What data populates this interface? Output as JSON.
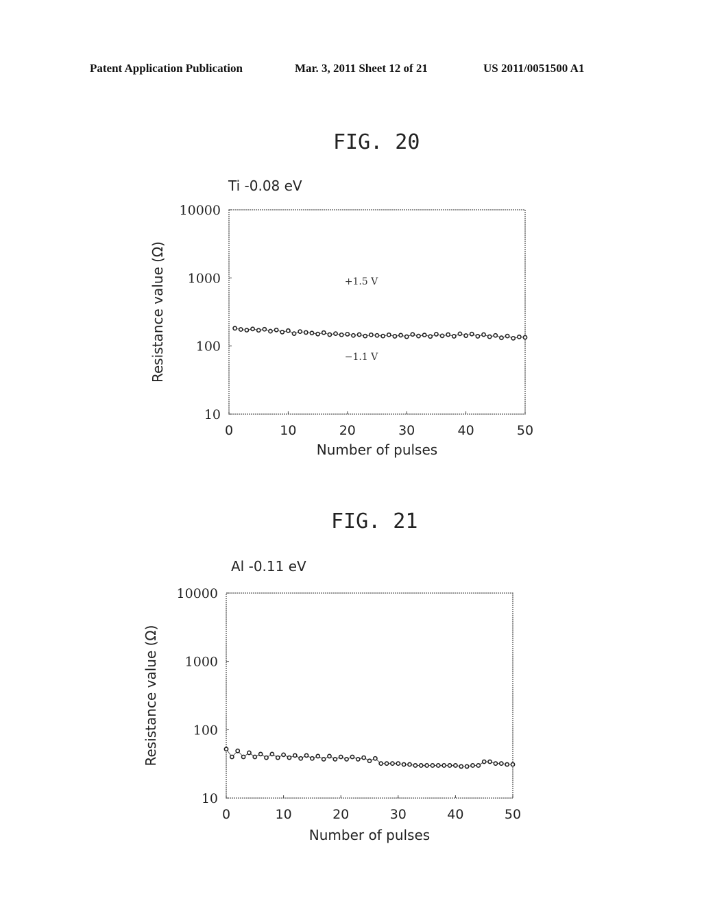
{
  "header": {
    "left": "Patent Application Publication",
    "middle": "Mar. 3, 2011   Sheet 12 of 21",
    "right": "US 2011/0051500 A1"
  },
  "chart_data": [
    {
      "type": "line",
      "figure_label": "FIG. 20",
      "title": "Ti  -0.08 eV",
      "xlabel": "Number of pulses",
      "ylabel": "Resistance value (Ω)",
      "xlim": [
        0,
        50
      ],
      "ylim": [
        10,
        10000
      ],
      "yscale": "log",
      "xticks": [
        "0",
        "10",
        "20",
        "30",
        "40",
        "50"
      ],
      "yticks": [
        "10",
        "100",
        "1000",
        "10000"
      ],
      "grid": false,
      "annotations": [
        {
          "text": "+1.5 V",
          "x": 22,
          "y": 900
        },
        {
          "text": "−1.1 V",
          "x": 22,
          "y": 70
        }
      ],
      "series": [
        {
          "name": "Ti",
          "x": [
            1,
            2,
            3,
            4,
            5,
            6,
            7,
            8,
            9,
            10,
            11,
            12,
            13,
            14,
            15,
            16,
            17,
            18,
            19,
            20,
            21,
            22,
            23,
            24,
            25,
            26,
            27,
            28,
            29,
            30,
            31,
            32,
            33,
            34,
            35,
            36,
            37,
            38,
            39,
            40,
            41,
            42,
            43,
            44,
            45,
            46,
            47,
            48,
            49,
            50
          ],
          "values": [
            182,
            175,
            171,
            178,
            170,
            176,
            165,
            172,
            160,
            168,
            152,
            163,
            158,
            155,
            150,
            157,
            147,
            152,
            146,
            149,
            143,
            147,
            140,
            146,
            143,
            140,
            146,
            139,
            144,
            137,
            148,
            140,
            145,
            138,
            149,
            141,
            147,
            139,
            151,
            142,
            150,
            139,
            147,
            137,
            143,
            132,
            140,
            130,
            136,
            134
          ]
        }
      ]
    },
    {
      "type": "line",
      "figure_label": "FIG. 21",
      "title": "Al  -0.11 eV",
      "xlabel": "Number of pulses",
      "ylabel": "Resistance value (Ω)",
      "xlim": [
        0,
        50
      ],
      "ylim": [
        10,
        10000
      ],
      "yscale": "log",
      "xticks": [
        "0",
        "10",
        "20",
        "30",
        "40",
        "50"
      ],
      "yticks": [
        "10",
        "100",
        "1000",
        "10000"
      ],
      "grid": false,
      "annotations": [],
      "series": [
        {
          "name": "Al",
          "x": [
            0,
            1,
            2,
            3,
            4,
            5,
            6,
            7,
            8,
            9,
            10,
            11,
            12,
            13,
            14,
            15,
            16,
            17,
            18,
            19,
            20,
            21,
            22,
            23,
            24,
            25,
            26,
            27,
            28,
            29,
            30,
            31,
            32,
            33,
            34,
            35,
            36,
            37,
            38,
            39,
            40,
            41,
            42,
            43,
            44,
            45,
            46,
            47,
            48,
            49,
            50
          ],
          "values": [
            52,
            40,
            49,
            40,
            46,
            40,
            44,
            39,
            44,
            39,
            43,
            39,
            42,
            38,
            42,
            38,
            41,
            37,
            41,
            37,
            40,
            37,
            40,
            37,
            39,
            35,
            38,
            32,
            32,
            32,
            32,
            31,
            31,
            30,
            30,
            30,
            30,
            30,
            30,
            30,
            30,
            29,
            29,
            30,
            30,
            34,
            34,
            32,
            32,
            31,
            31
          ]
        }
      ]
    }
  ]
}
